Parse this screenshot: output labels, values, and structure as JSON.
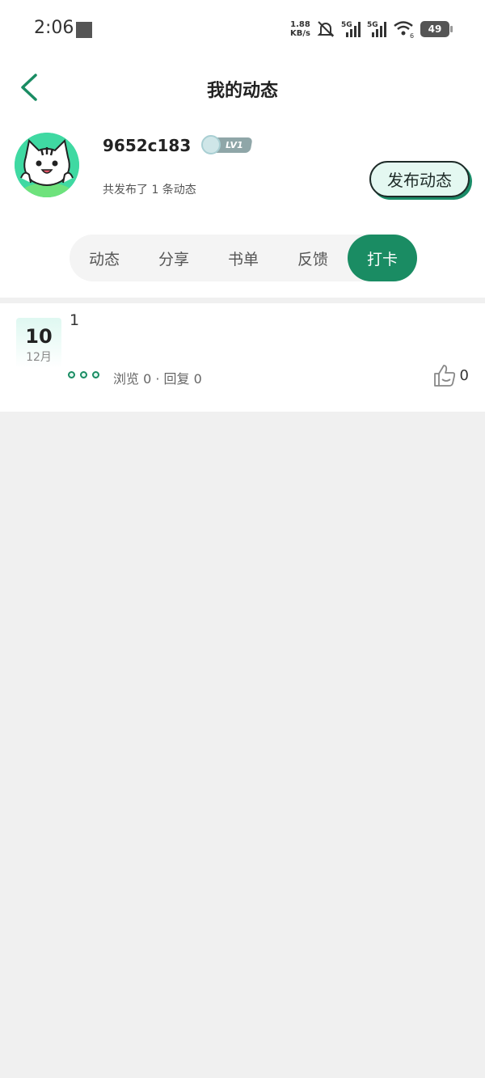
{
  "status_bar": {
    "time": "2:06",
    "net_speed_value": "1.88",
    "net_speed_unit": "KB/s",
    "sim1": "5G",
    "sim2": "5G",
    "wifi_sub": "6",
    "battery": "49"
  },
  "header": {
    "title": "我的动态",
    "back_icon": "chevron-left-icon"
  },
  "profile": {
    "username": "9652c183",
    "level": "LV1",
    "post_count_text": "共发布了 1 条动态",
    "publish_button": "发布动态"
  },
  "tabs": [
    {
      "label": "动态",
      "active": false
    },
    {
      "label": "分享",
      "active": false
    },
    {
      "label": "书单",
      "active": false
    },
    {
      "label": "反馈",
      "active": false
    },
    {
      "label": "打卡",
      "active": true
    }
  ],
  "entries": [
    {
      "day": "10",
      "month": "12月",
      "text": "1",
      "stats": "浏览 0 · 回复 0",
      "likes": "0"
    }
  ],
  "colors": {
    "accent": "#1a8c63",
    "background": "#f0f0f0"
  }
}
